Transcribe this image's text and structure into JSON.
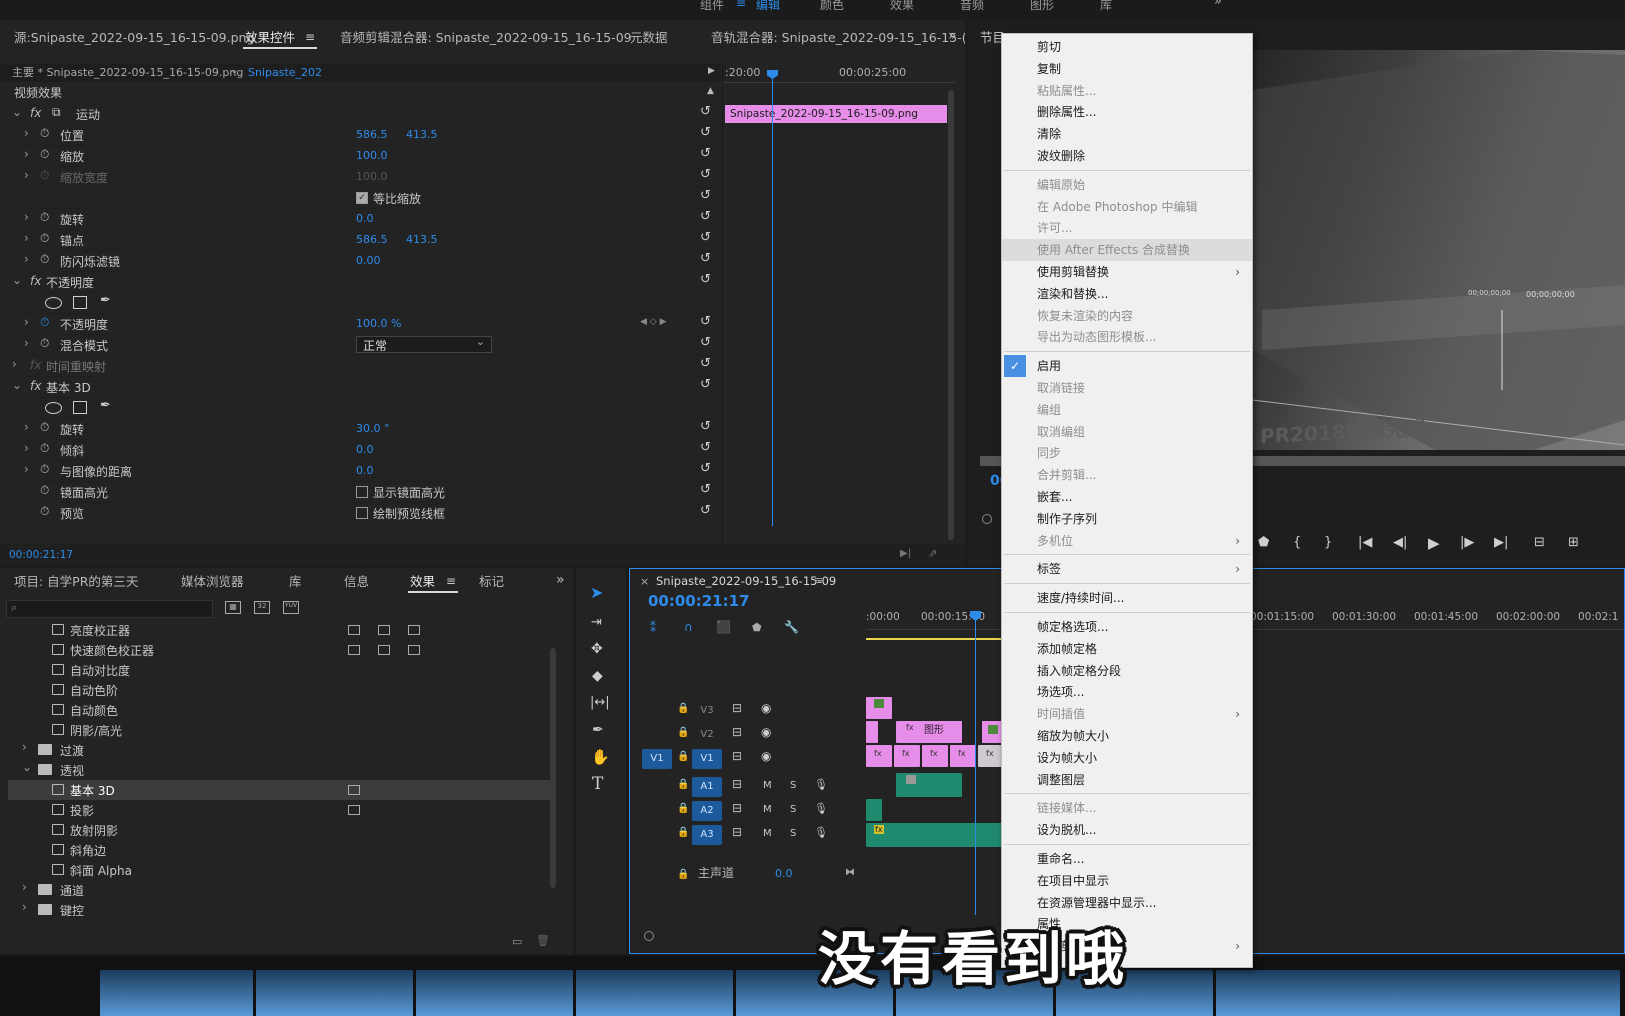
{
  "top_workspaces": [
    "组件",
    "编辑",
    "颜色",
    "效果",
    "音频",
    "图形",
    "库"
  ],
  "effect_controls": {
    "tabs": [
      {
        "label": "源:Snipaste_2022-09-15_16-15-09.png"
      },
      {
        "label": "效果控件"
      },
      {
        "label": "音频剪辑混合器: Snipaste_2022-09-15_16-15-09"
      },
      {
        "label": "元数据"
      },
      {
        "label": "音轨混合器: Snipaste_2022-09-15_16-15-("
      }
    ],
    "master_label": "主要 * Snipaste_2022-09-15_16-15-09.png",
    "sequence_label": "Snipaste_202",
    "section_label": "视频效果",
    "time_left": ":20:00",
    "time_right": "00:00:25:00",
    "clip_label": "Snipaste_2022-09-15_16-15-09.png",
    "footer_time": "00:00:21:17",
    "rows": [
      {
        "label": "运动",
        "fx": true
      },
      {
        "label": "位置",
        "v1": "586.5",
        "v2": "413.5"
      },
      {
        "label": "缩放",
        "v1": "100.0"
      },
      {
        "label": "缩放宽度",
        "v1": "100.0",
        "disabled": true
      },
      {
        "label": "",
        "checkbox": "等比缩放"
      },
      {
        "label": "旋转",
        "v1": "0.0"
      },
      {
        "label": "锚点",
        "v1": "586.5",
        "v2": "413.5"
      },
      {
        "label": "防闪烁滤镜",
        "v1": "0.00"
      },
      {
        "label": "不透明度",
        "fx": true
      },
      {
        "label": "",
        "masks": true
      },
      {
        "label": "不透明度",
        "v1": "100.0 %"
      },
      {
        "label": "混合模式",
        "select": "正常"
      },
      {
        "label": "时间重映射",
        "fx": true
      },
      {
        "label": "基本 3D",
        "fx": true
      },
      {
        "label": "",
        "masks": true
      },
      {
        "label": "旋转",
        "v1": "30.0 °"
      },
      {
        "label": "倾斜",
        "v1": "0.0"
      },
      {
        "label": "与图像的距离",
        "v1": "0.0"
      },
      {
        "label": "镜面高光",
        "checkbox": "显示镜面高光"
      },
      {
        "label": "预览",
        "checkbox": "绘制预览线框"
      }
    ]
  },
  "project_panel": {
    "tabs": [
      "项目: 自学PR的第三天",
      "媒体浏览器",
      "库",
      "信息",
      "效果",
      "标记"
    ],
    "items": [
      {
        "label": "亮度校正器",
        "indent": 2
      },
      {
        "label": "快速颜色校正器",
        "indent": 2
      },
      {
        "label": "自动对比度",
        "indent": 2
      },
      {
        "label": "自动色阶",
        "indent": 2
      },
      {
        "label": "自动颜色",
        "indent": 2
      },
      {
        "label": "阴影/高光",
        "indent": 2
      },
      {
        "label": "过渡",
        "indent": 1,
        "folder": true
      },
      {
        "label": "透视",
        "indent": 1,
        "folder": true,
        "open": true
      },
      {
        "label": "基本 3D",
        "indent": 2,
        "selected": true
      },
      {
        "label": "投影",
        "indent": 2
      },
      {
        "label": "放射阴影",
        "indent": 2
      },
      {
        "label": "斜角边",
        "indent": 2
      },
      {
        "label": "斜面 Alpha",
        "indent": 2
      },
      {
        "label": "通道",
        "indent": 1,
        "folder": true
      },
      {
        "label": "键控",
        "indent": 1,
        "folder": true
      }
    ]
  },
  "program_monitor": {
    "title": "节目",
    "timecode": "00",
    "overlay_text": "PR2018编辑完成",
    "tc_a": "00;00;00;00",
    "tc_b": "00;00;00;00"
  },
  "timeline": {
    "tab_label": "Snipaste_2022-09-15_16-15-09",
    "timecode": "00:00:21:17",
    "ruler": [
      ":00:00",
      "00:00:15:00",
      "00:01:15:00",
      "00:01:30:00",
      "00:01:45:00",
      "00:02:00:00",
      "00:02:1"
    ],
    "tracks": [
      "V3",
      "V2",
      "V1",
      "A1",
      "A2",
      "A3"
    ],
    "source_v1": "V1",
    "master_label": "主声道",
    "master_value": "0.0",
    "clip_graphic": "图形",
    "mute": "M",
    "solo": "S"
  },
  "context_menu": {
    "items": [
      {
        "label": "剪切"
      },
      {
        "label": "复制"
      },
      {
        "label": "粘贴属性...",
        "disabled": true
      },
      {
        "label": "删除属性..."
      },
      {
        "label": "清除"
      },
      {
        "label": "波纹删除"
      },
      {
        "sep": true
      },
      {
        "label": "编辑原始",
        "disabled": true
      },
      {
        "label": "在 Adobe Photoshop 中编辑",
        "disabled": true
      },
      {
        "label": "许可...",
        "disabled": true
      },
      {
        "label": "使用 After Effects 合成替换",
        "disabled": true,
        "highlight": true
      },
      {
        "label": "使用剪辑替换",
        "submenu": true
      },
      {
        "label": "渲染和替换..."
      },
      {
        "label": "恢复未渲染的内容",
        "disabled": true
      },
      {
        "label": "导出为动态图形模板...",
        "disabled": true
      },
      {
        "sep": true
      },
      {
        "label": "启用",
        "checked": true
      },
      {
        "label": "取消链接",
        "disabled": true
      },
      {
        "label": "编组",
        "disabled": true
      },
      {
        "label": "取消编组",
        "disabled": true
      },
      {
        "label": "同步",
        "disabled": true
      },
      {
        "label": "合并剪辑...",
        "disabled": true
      },
      {
        "label": "嵌套..."
      },
      {
        "label": "制作子序列"
      },
      {
        "label": "多机位",
        "disabled": true,
        "submenu": true
      },
      {
        "sep": true
      },
      {
        "label": "标签",
        "submenu": true
      },
      {
        "sep": true
      },
      {
        "label": "速度/持续时间..."
      },
      {
        "sep": true
      },
      {
        "label": "帧定格选项..."
      },
      {
        "label": "添加帧定格"
      },
      {
        "label": "插入帧定格分段"
      },
      {
        "label": "场选项..."
      },
      {
        "label": "时间插值",
        "disabled": true,
        "submenu": true
      },
      {
        "label": "缩放为帧大小"
      },
      {
        "label": "设为帧大小"
      },
      {
        "label": "调整图层"
      },
      {
        "sep": true
      },
      {
        "label": "链接媒体...",
        "disabled": true
      },
      {
        "label": "设为脱机..."
      },
      {
        "sep": true
      },
      {
        "label": "重命名..."
      },
      {
        "label": "在项目中显示"
      },
      {
        "label": "在资源管理器中显示..."
      },
      {
        "label": "属性"
      },
      {
        "label": "显示剪辑关键帧",
        "submenu": true
      }
    ]
  },
  "subtitle": "没有看到哦",
  "colors": {
    "accent": "#2d8ceb",
    "clip_pink": "#e58de8",
    "audio_green": "#1f8a6e",
    "menu_bg": "#f0f0f0"
  }
}
